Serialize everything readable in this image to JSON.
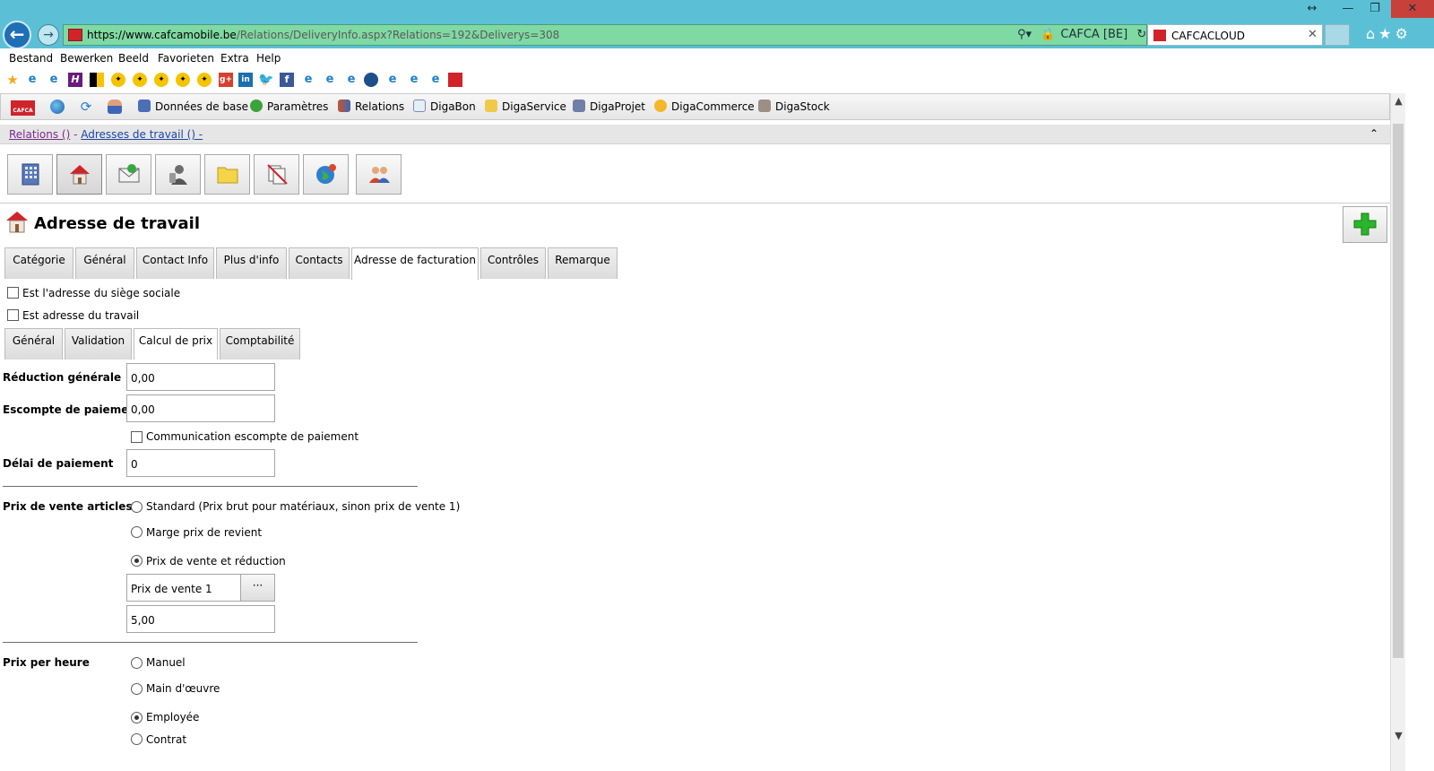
{
  "browser": {
    "url_host": "https://www.cafcamobile.be",
    "url_path": "/Relations/DeliveryInfo.aspx?Relations=192&Deliverys=308",
    "security_label": "CAFCA [BE]",
    "tab_title": "CAFCACLOUD"
  },
  "menu": {
    "items": [
      "Bestand",
      "Bewerken",
      "Beeld",
      "Favorieten",
      "Extra",
      "Help"
    ]
  },
  "app_toolbar": {
    "items": [
      "Données de base",
      "Paramètres",
      "Relations",
      "DigaBon",
      "DigaService",
      "DigaProjet",
      "DigaCommerce",
      "DigaStock"
    ]
  },
  "breadcrumb": {
    "crumb1": "Relations ()",
    "separator": " - ",
    "crumb2": "Adresses de travail () -",
    "collapse_icon": "double-chevron-up-icon"
  },
  "page": {
    "title": "Adresse de travail"
  },
  "tabs": [
    "Catégorie",
    "Général",
    "Contact Info",
    "Plus d'info",
    "Contacts",
    "Adresse de facturation",
    "Contrôles",
    "Remarque"
  ],
  "active_tab": "Adresse de facturation",
  "checkboxes": {
    "head_office": "Est l'adresse du siège sociale",
    "work_address": "Est adresse du travail"
  },
  "subtabs": [
    "Général",
    "Validation",
    "Calcul de prix",
    "Comptabilité"
  ],
  "active_subtab": "Calcul de prix",
  "form": {
    "general_discount_label": "Réduction générale",
    "general_discount_value": "0,00",
    "payment_discount_label": "Escompte de paiement",
    "payment_discount_value": "0,00",
    "payment_discount_comm_label": "Communication escompte de paiement",
    "payment_term_label": "Délai de paiement",
    "payment_term_value": "0",
    "sale_price_label": "Prix de vente articles",
    "sale_price_options": [
      "Standard (Prix brut pour matériaux, sinon prix de vente 1)",
      "Marge prix de revient",
      "Prix de vente et réduction"
    ],
    "sale_price_selected": "Prix de vente et réduction",
    "pricelist_value": "Prix de vente 1",
    "pricelist_button": "···",
    "discount_value": "5,00",
    "hourly_price_label": "Prix per heure",
    "hourly_options": [
      "Manuel",
      "Main d'œuvre",
      "Employée",
      "Contrat"
    ],
    "hourly_selected": "Employée"
  },
  "colors": {
    "chrome": "#5bc0d6",
    "address_bar": "#7fd9a3",
    "brand_red": "#d1232a",
    "link_visited": "#7b2a8c",
    "link": "#1a45a8",
    "add_green": "#2bb52b"
  }
}
